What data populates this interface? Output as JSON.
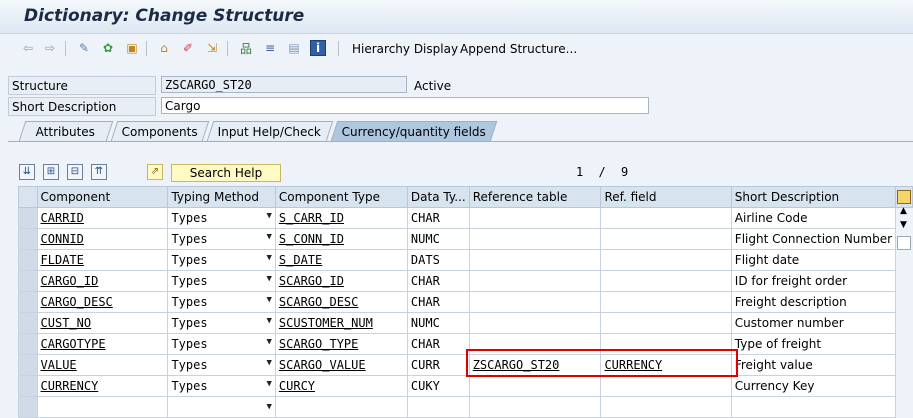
{
  "window": {
    "title": "Dictionary: Change Structure"
  },
  "toolbar": {
    "icons": [
      "back-icon",
      "forward-icon",
      "other-object-icon",
      "display-change-icon",
      "activate-icon",
      "check-icon",
      "where-used-icon",
      "edit-icon",
      "object-list-icon",
      "hierarchy-icon",
      "info-icon"
    ],
    "hierarchy_display": "Hierarchy Display",
    "append_structure": "Append Structure..."
  },
  "header": {
    "structure_label": "Structure",
    "structure_value": "ZSCARGO_ST20",
    "status": "Active",
    "short_desc_label": "Short Description",
    "short_desc_value": "Cargo"
  },
  "tabs": [
    {
      "label": "Attributes",
      "active": false
    },
    {
      "label": "Components",
      "active": false
    },
    {
      "label": "Input Help/Check",
      "active": false
    },
    {
      "label": "Currency/quantity fields",
      "active": true
    }
  ],
  "table_toolbar": {
    "search_help": "Search Help",
    "page": "1",
    "sep": "/",
    "total": "9"
  },
  "columns": [
    "Component",
    "Typing Method",
    "Component Type",
    "Data Ty...",
    "Reference table",
    "Ref. field",
    "Short Description"
  ],
  "rows": [
    {
      "component": "CARRID",
      "typing": "Types",
      "ctype": "S_CARR_ID",
      "dtype": "CHAR",
      "reftab": "",
      "reffield": "",
      "desc": "Airline Code"
    },
    {
      "component": "CONNID",
      "typing": "Types",
      "ctype": "S_CONN_ID",
      "dtype": "NUMC",
      "reftab": "",
      "reffield": "",
      "desc": "Flight Connection Number"
    },
    {
      "component": "FLDATE",
      "typing": "Types",
      "ctype": "S_DATE",
      "dtype": "DATS",
      "reftab": "",
      "reffield": "",
      "desc": "Flight date"
    },
    {
      "component": "CARGO_ID",
      "typing": "Types",
      "ctype": "SCARGO_ID",
      "dtype": "CHAR",
      "reftab": "",
      "reffield": "",
      "desc": "ID for freight order"
    },
    {
      "component": "CARGO_DESC",
      "typing": "Types",
      "ctype": "SCARGO_DESC",
      "dtype": "CHAR",
      "reftab": "",
      "reffield": "",
      "desc": "Freight description"
    },
    {
      "component": "CUST_NO",
      "typing": "Types",
      "ctype": "SCUSTOMER_NUM",
      "dtype": "NUMC",
      "reftab": "",
      "reffield": "",
      "desc": "Customer number"
    },
    {
      "component": "CARGOTYPE",
      "typing": "Types",
      "ctype": "SCARGO_TYPE",
      "dtype": "CHAR",
      "reftab": "",
      "reffield": "",
      "desc": "Type of freight"
    },
    {
      "component": "VALUE",
      "typing": "Types",
      "ctype": "SCARGO_VALUE",
      "dtype": "CURR",
      "reftab": "ZSCARGO_ST20",
      "reffield": "CURRENCY",
      "desc": "Freight value"
    },
    {
      "component": "CURRENCY",
      "typing": "Types",
      "ctype": "CURCY",
      "dtype": "CUKY",
      "reftab": "",
      "reffield": "",
      "desc": "Currency Key"
    },
    {
      "component": "",
      "typing": "",
      "ctype": "",
      "dtype": "",
      "reftab": "",
      "reffield": "",
      "desc": ""
    }
  ],
  "colors": {
    "highlight": "#e00000",
    "active_tab": "#aec6de",
    "header_bg": "#d7e3ef"
  }
}
